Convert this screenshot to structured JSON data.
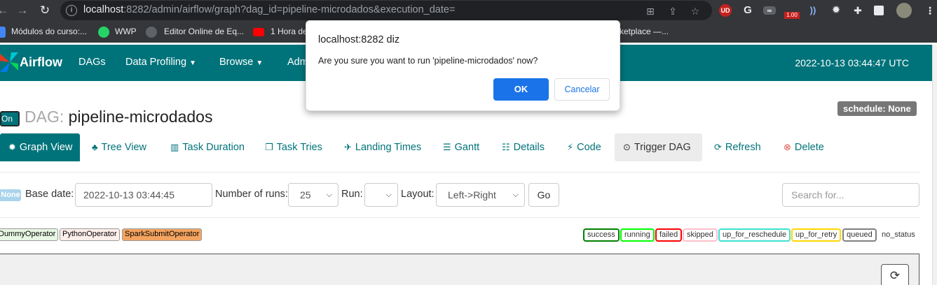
{
  "browser": {
    "url_host": "localhost",
    "url_rest": ":8282/admin/airflow/graph?dag_id=pipeline-microdados&execution_date=",
    "ext_badge": "1.00",
    "ext_ud": "UD",
    "bookmarks": [
      {
        "label": "Módulos do curso:..."
      },
      {
        "label": "WWP"
      },
      {
        "label": "Editor Online de Eq..."
      },
      {
        "label": "1 Hora de"
      },
      {
        "label": "ketplace —..."
      }
    ]
  },
  "navbar": {
    "brand": "Airflow",
    "items": [
      "DAGs",
      "Data Profiling",
      "Browse",
      "Adm"
    ],
    "time": "2022-10-13 03:44:47 UTC"
  },
  "dag": {
    "toggle": "On",
    "prefix": "DAG:",
    "name": "pipeline-microdados",
    "schedule": "schedule: None"
  },
  "tabs": [
    {
      "label": "Graph View",
      "icon": "asterisk-icon"
    },
    {
      "label": "Tree View",
      "icon": "tree-icon"
    },
    {
      "label": "Task Duration",
      "icon": "bar-chart-icon"
    },
    {
      "label": "Task Tries",
      "icon": "duplicate-icon"
    },
    {
      "label": "Landing Times",
      "icon": "plane-icon"
    },
    {
      "label": "Gantt",
      "icon": "align-left-icon"
    },
    {
      "label": "Details",
      "icon": "list-icon"
    },
    {
      "label": "Code",
      "icon": "flash-icon"
    },
    {
      "label": "Trigger DAG",
      "icon": "play-icon"
    },
    {
      "label": "Refresh",
      "icon": "refresh-icon"
    },
    {
      "label": "Delete",
      "icon": "remove-icon"
    }
  ],
  "controls": {
    "none_badge": "None",
    "base_date_label": "Base date:",
    "base_date_value": "2022-10-13 03:44:45",
    "runs_label": "Number of runs:",
    "runs_value": "25",
    "run_label": "Run:",
    "run_value": "",
    "layout_label": "Layout:",
    "layout_value": "Left->Right",
    "go": "Go",
    "search_placeholder": "Search for..."
  },
  "operators": [
    {
      "label": "DummyOperator",
      "color": "#e8f7e4"
    },
    {
      "label": "PythonOperator",
      "color": "#ffefeb"
    },
    {
      "label": "SparkSubmitOperator",
      "color": "#f4a460"
    }
  ],
  "states": [
    {
      "label": "success",
      "color": "#008000"
    },
    {
      "label": "running",
      "color": "#00ff00"
    },
    {
      "label": "failed",
      "color": "#ff0000"
    },
    {
      "label": "skipped",
      "color": "#ffc0cb"
    },
    {
      "label": "up_for_reschedule",
      "color": "#40e0d0"
    },
    {
      "label": "up_for_retry",
      "color": "#ffd700"
    },
    {
      "label": "queued",
      "color": "#808080"
    },
    {
      "label": "no_status",
      "color": "#ffffff"
    }
  ],
  "modal": {
    "title": "localhost:8282 diz",
    "message": "Are you sure you want to run 'pipeline-microdados' now?",
    "ok": "OK",
    "cancel": "Cancelar"
  }
}
